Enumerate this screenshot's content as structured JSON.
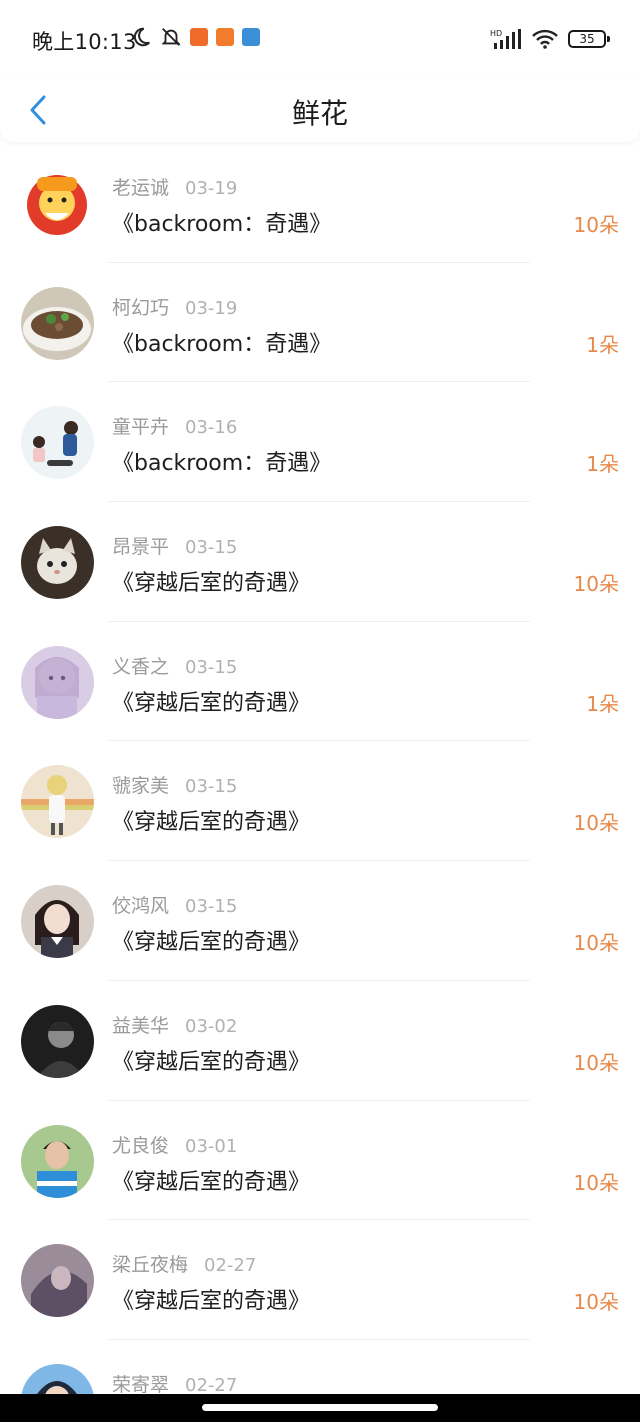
{
  "status_bar": {
    "time": "晚上10:13",
    "battery": "35",
    "network": "HD"
  },
  "nav": {
    "title": "鲜花",
    "back_icon": "chevron-left-icon"
  },
  "colors": {
    "accent_blue": "#2e8fe0",
    "amount_orange": "#e8894a"
  },
  "records": [
    {
      "name": "老运诚",
      "date": "03-19",
      "book": "《backroom：奇遇》",
      "amount": "10朵"
    },
    {
      "name": "柯幻巧",
      "date": "03-19",
      "book": "《backroom：奇遇》",
      "amount": "1朵"
    },
    {
      "name": "童平卉",
      "date": "03-16",
      "book": "《backroom：奇遇》",
      "amount": "1朵"
    },
    {
      "name": "昂景平",
      "date": "03-15",
      "book": "《穿越后室的奇遇》",
      "amount": "10朵"
    },
    {
      "name": "义香之",
      "date": "03-15",
      "book": "《穿越后室的奇遇》",
      "amount": "1朵"
    },
    {
      "name": "虢家美",
      "date": "03-15",
      "book": "《穿越后室的奇遇》",
      "amount": "10朵"
    },
    {
      "name": "佼鸿风",
      "date": "03-15",
      "book": "《穿越后室的奇遇》",
      "amount": "10朵"
    },
    {
      "name": "益美华",
      "date": "03-02",
      "book": "《穿越后室的奇遇》",
      "amount": "10朵"
    },
    {
      "name": "尤良俊",
      "date": "03-01",
      "book": "《穿越后室的奇遇》",
      "amount": "10朵"
    },
    {
      "name": "梁丘夜梅",
      "date": "02-27",
      "book": "《穿越后室的奇遇》",
      "amount": "10朵"
    },
    {
      "name": "荣寄翠",
      "date": "02-27",
      "book": "",
      "amount": ""
    }
  ]
}
